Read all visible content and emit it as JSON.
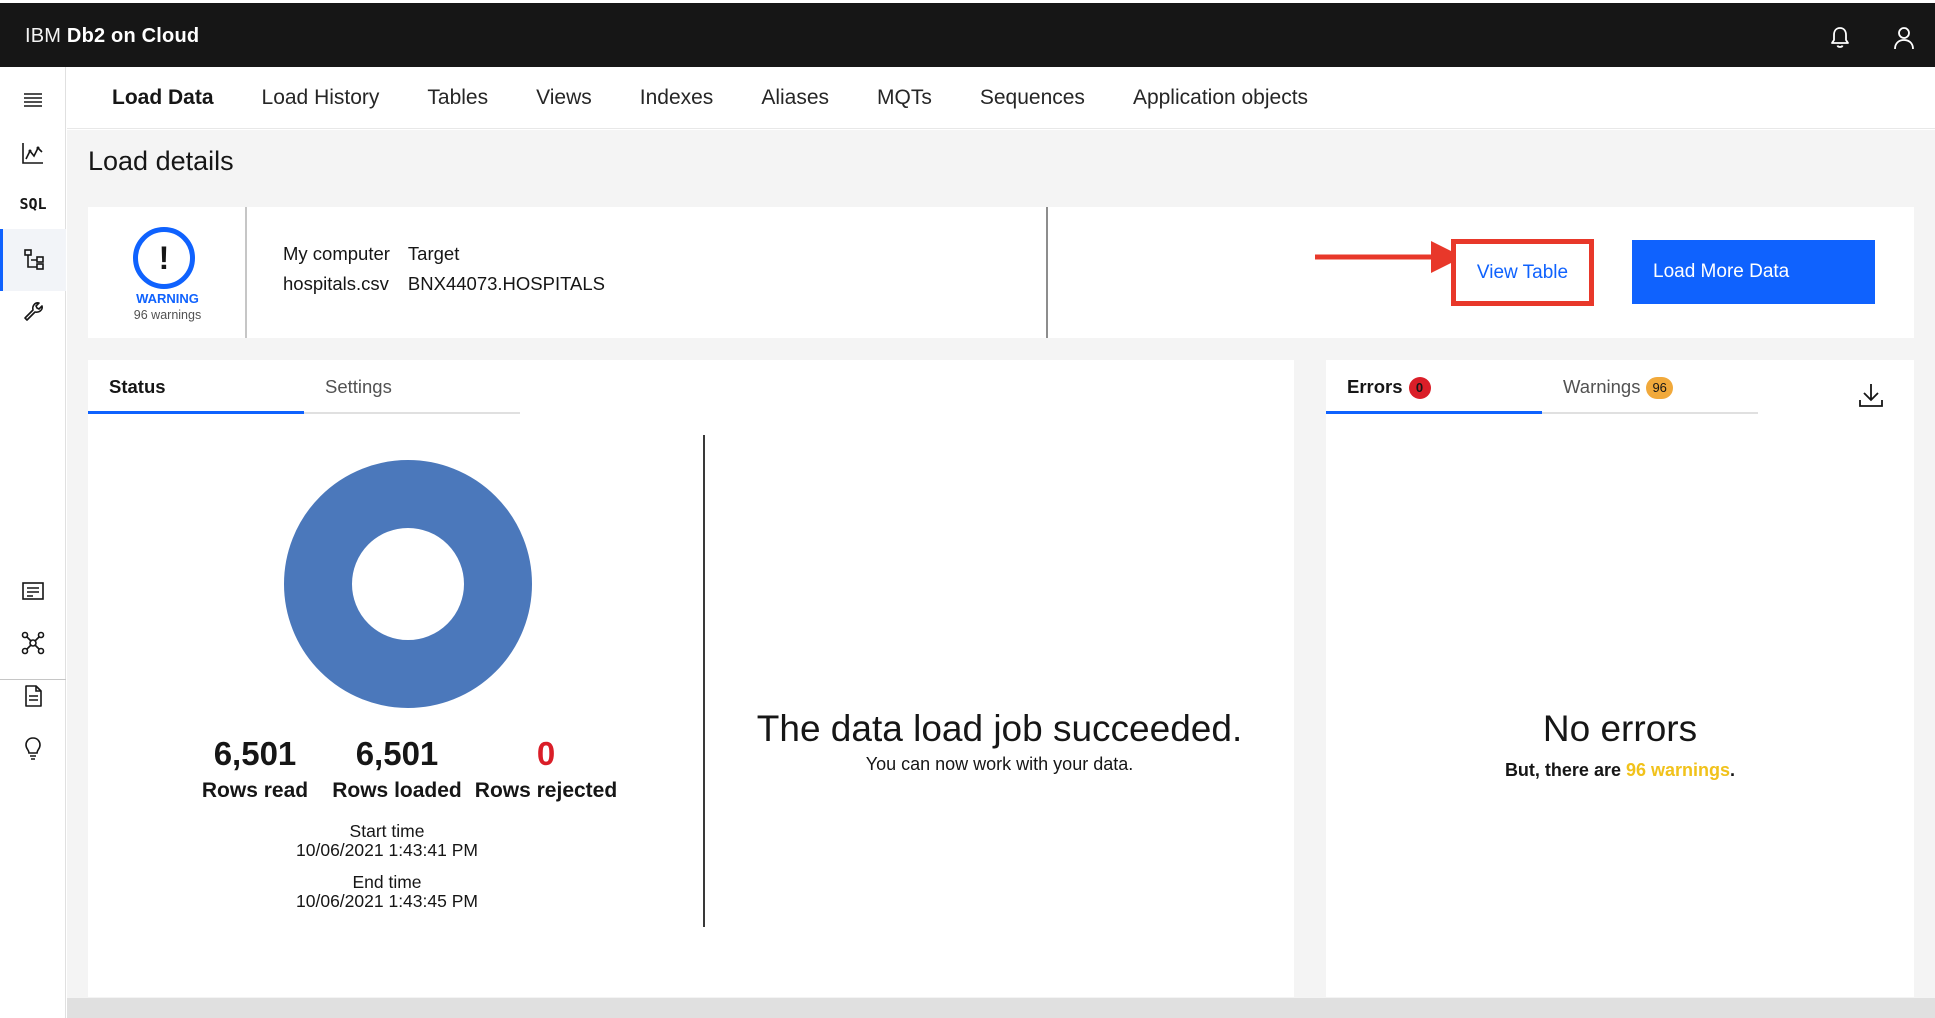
{
  "topbar": {
    "brand_prefix": "IBM ",
    "brand_name": "Db2 on Cloud",
    "icons": [
      "notification-icon",
      "user-icon"
    ]
  },
  "rail": {
    "items": [
      "menu-icon",
      "monitor-icon",
      "sql-icon",
      "data-icon",
      "administration-icon",
      "summary-icon",
      "connection-icon",
      "document-icon",
      "idea-icon"
    ],
    "sql_label": "SQL",
    "active": "data-icon"
  },
  "tabs": [
    "Load Data",
    "Load History",
    "Tables",
    "Views",
    "Indexes",
    "Aliases",
    "MQTs",
    "Sequences",
    "Application objects"
  ],
  "active_tab": "Load Data",
  "page_title": "Load details",
  "details": {
    "status_title": "WARNING",
    "status_sub": "96 warnings",
    "source_label": "My computer",
    "target_label": "Target",
    "source_value": "hospitals.csv",
    "target_value": "BNX44073.HOSPITALS",
    "view_table": "View Table",
    "load_more": "Load More Data",
    "highlight_color": "#e8382a"
  },
  "status_panel": {
    "tabs": [
      "Status",
      "Settings"
    ],
    "active_tab": "Status",
    "rows_read": "6,501",
    "rows_read_label": "Rows read",
    "rows_loaded": "6,501",
    "rows_loaded_label": "Rows loaded",
    "rows_rejected": "0",
    "rows_rejected_label": "Rows rejected",
    "start_label": "Start time",
    "start_value": "10/06/2021 1:43:41 PM",
    "end_label": "End time",
    "end_value": "10/06/2021 1:43:45 PM",
    "success_title": "The data load job succeeded.",
    "success_sub": "You can now work with your data.",
    "donut_color": "#4b78bb"
  },
  "errors_panel": {
    "errors_label": "Errors",
    "errors_count": "0",
    "warnings_label": "Warnings",
    "warnings_count": "96",
    "title": "No errors",
    "sub_prefix": "But, there are ",
    "sub_link": "96 warnings",
    "sub_suffix": "."
  },
  "colors": {
    "accent": "#0f62fe",
    "error": "#da1e28",
    "warning": "#f1a93b"
  }
}
